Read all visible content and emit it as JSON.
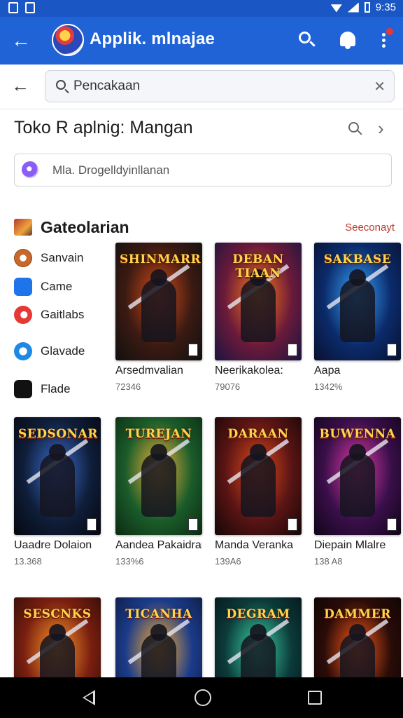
{
  "status_bar": {
    "time": "9:35"
  },
  "app_bar": {
    "title": "Applik. mlnajae"
  },
  "search": {
    "placeholder": "Pencakaan"
  },
  "heading": {
    "title": "Toko R aplnig: Mangan"
  },
  "sub_input": {
    "placeholder": "Mla. Drogelldyinllanan"
  },
  "categories": {
    "title": "Gateolarian",
    "see_all": "Seeconayt",
    "items": [
      {
        "label": "Sanvain",
        "icon": "coin-icon"
      },
      {
        "label": "Came",
        "icon": "check-icon"
      },
      {
        "label": "Gaitlabs",
        "icon": "record-icon"
      },
      {
        "label": "Glavade",
        "icon": "bubble-icon"
      },
      {
        "label": "Flade",
        "icon": "film-icon"
      }
    ]
  },
  "games": [
    {
      "art": "SHINMARR",
      "name": "Arsedmvalian",
      "meta": "72346",
      "colors": [
        "#3b1a12",
        "#d64b1c",
        "#101010"
      ]
    },
    {
      "art": "DEBAN TIAAN",
      "name": "Neerikakolea:",
      "meta": "79076",
      "colors": [
        "#6b1a3a",
        "#ff7a1a",
        "#1b1440"
      ]
    },
    {
      "art": "SAKBASE",
      "name": "Aapa",
      "meta": "1342%",
      "colors": [
        "#0b2b6b",
        "#38a5ff",
        "#0a1030"
      ]
    },
    {
      "art": "SEDSONAR",
      "name": "Uaadre Dolaion",
      "meta": "13.368",
      "colors": [
        "#0f1e3a",
        "#3b6ed1",
        "#05070f"
      ]
    },
    {
      "art": "TUREJAN",
      "name": "Aandea Pakaidran",
      "meta": "133%6",
      "colors": [
        "#1a5c2a",
        "#f2b43a",
        "#0c2a12"
      ]
    },
    {
      "art": "DARAAN",
      "name": "Manda Veranka",
      "meta": "139A6",
      "colors": [
        "#5a1414",
        "#e04a1c",
        "#140606"
      ]
    },
    {
      "art": "BUWENNA",
      "name": "Diepain Mlalre",
      "meta": "138 A8",
      "colors": [
        "#3a0f4a",
        "#e03aa8",
        "#100518"
      ]
    },
    {
      "art": "SESCNKS",
      "name": "",
      "meta": "",
      "colors": [
        "#7a1f10",
        "#ff9a2a",
        "#2a0c08"
      ]
    },
    {
      "art": "TICANHA",
      "name": "",
      "meta": "",
      "colors": [
        "#1b3b8a",
        "#ffb02e",
        "#0e1a40"
      ]
    },
    {
      "art": "DEGRAM",
      "name": "",
      "meta": "",
      "colors": [
        "#0c3a3a",
        "#3ad6a8",
        "#04141a"
      ]
    },
    {
      "art": "DAMMER",
      "name": "",
      "meta": "",
      "colors": [
        "#2a0c08",
        "#ff5a1a",
        "#0a0404"
      ]
    }
  ],
  "nav_bar": {
    "back_icon": "back-triangle-icon",
    "home_icon": "home-circle-icon",
    "recent_icon": "recent-square-icon"
  }
}
